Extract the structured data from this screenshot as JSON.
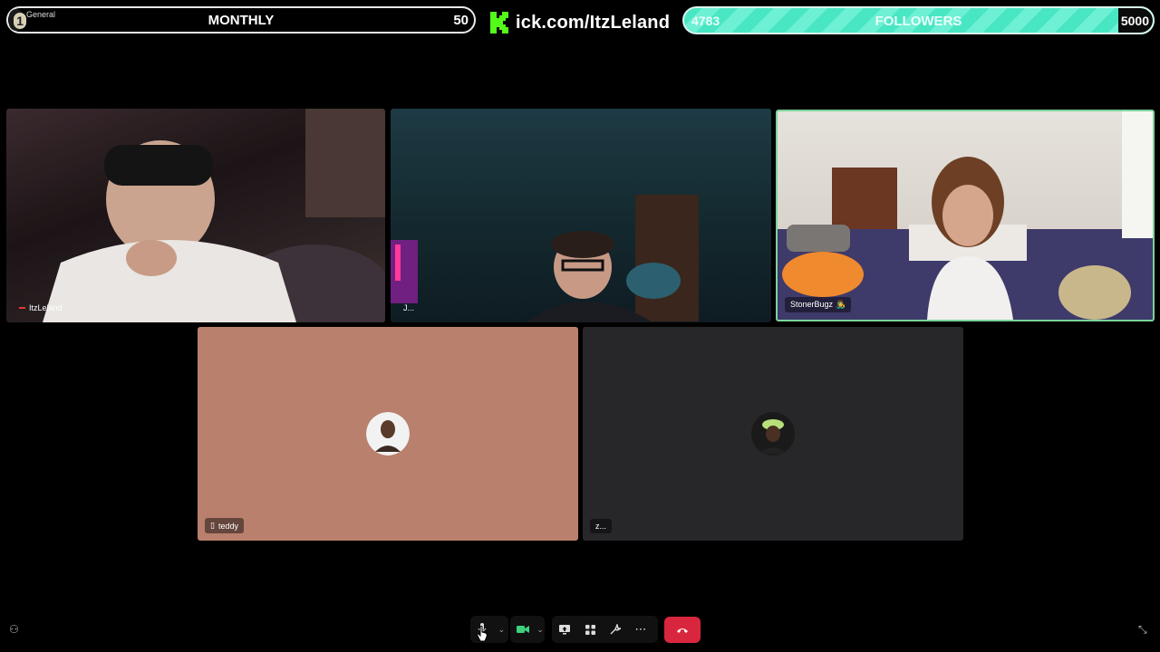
{
  "overlay": {
    "goal": {
      "level": "1",
      "category": "General",
      "title": "MONTHLY",
      "target": "50",
      "progress_fraction": 0.02
    },
    "kick_url": "ick.com/ItzLeland",
    "followers": {
      "current": "4783",
      "label": "FOLLOWERS",
      "target": "5000",
      "progress_fraction": 0.957
    }
  },
  "participants": [
    {
      "name": "ItzLeland"
    },
    {
      "name": "J..."
    },
    {
      "name": "StonerBugz 👨‍🎤"
    },
    {
      "name": "teddy"
    },
    {
      "name": "z..."
    }
  ],
  "colors": {
    "teddy_tile": "#b9806d",
    "z_tile": "#27272a",
    "active_speaker_border": "#7cd39a",
    "end_call": "#d9263f",
    "followers_bar": "#49e6c4"
  },
  "controls": {
    "mic": "hand-raise-mic-icon",
    "camera": "camera-icon",
    "share": "screen-share-icon",
    "apps": "apps-icon",
    "effects": "effects-icon",
    "more": "more-icon",
    "end_call": "end-call-icon"
  }
}
